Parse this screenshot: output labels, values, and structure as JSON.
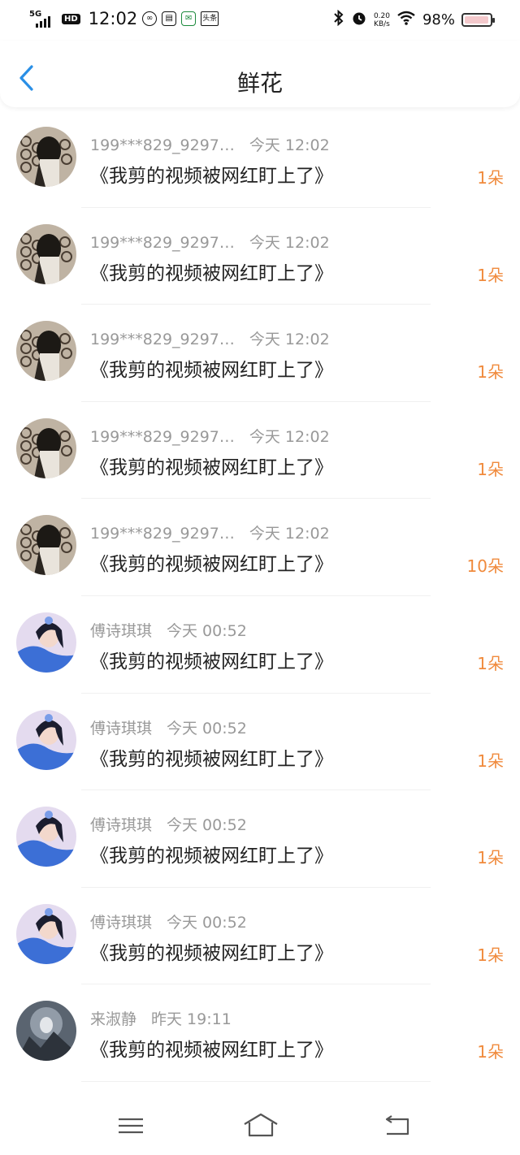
{
  "status_bar": {
    "network": "5G",
    "hd": "HD",
    "time": "12:02",
    "net_speed_value": "0.20",
    "net_speed_unit": "KB/s",
    "battery_pct": "98%",
    "battery_level": 0.98,
    "battery_color": "#f4c9cc",
    "mini_icons": [
      "soul-app-icon",
      "calendar-icon",
      "post-icon",
      "toutiao-icon"
    ],
    "mini_texts": [
      "",
      "",
      "",
      "头条"
    ],
    "right_icons": [
      "bluetooth-icon",
      "alarm-icon",
      "wifi-icon"
    ]
  },
  "header": {
    "title": "鲜花",
    "back_icon": "chevron-left-icon",
    "accent": "#2a8fe6"
  },
  "colors": {
    "count": "#f08a3c",
    "meta": "#999999"
  },
  "items": [
    {
      "name": "199***829_9297…",
      "time": "今天 12:02",
      "message": "《我剪的视频被网红盯上了》",
      "count": "1朵",
      "avatar": "avatar-user-199"
    },
    {
      "name": "199***829_9297…",
      "time": "今天 12:02",
      "message": "《我剪的视频被网红盯上了》",
      "count": "1朵",
      "avatar": "avatar-user-199"
    },
    {
      "name": "199***829_9297…",
      "time": "今天 12:02",
      "message": "《我剪的视频被网红盯上了》",
      "count": "1朵",
      "avatar": "avatar-user-199"
    },
    {
      "name": "199***829_9297…",
      "time": "今天 12:02",
      "message": "《我剪的视频被网红盯上了》",
      "count": "1朵",
      "avatar": "avatar-user-199"
    },
    {
      "name": "199***829_9297…",
      "time": "今天 12:02",
      "message": "《我剪的视频被网红盯上了》",
      "count": "10朵",
      "avatar": "avatar-user-199"
    },
    {
      "name": "傅诗琪琪",
      "time": "今天 00:52",
      "message": "《我剪的视频被网红盯上了》",
      "count": "1朵",
      "avatar": "avatar-user-fu"
    },
    {
      "name": "傅诗琪琪",
      "time": "今天 00:52",
      "message": "《我剪的视频被网红盯上了》",
      "count": "1朵",
      "avatar": "avatar-user-fu"
    },
    {
      "name": "傅诗琪琪",
      "time": "今天 00:52",
      "message": "《我剪的视频被网红盯上了》",
      "count": "1朵",
      "avatar": "avatar-user-fu"
    },
    {
      "name": "傅诗琪琪",
      "time": "今天 00:52",
      "message": "《我剪的视频被网红盯上了》",
      "count": "1朵",
      "avatar": "avatar-user-fu"
    },
    {
      "name": "来淑静",
      "time": "昨天 19:11",
      "message": "《我剪的视频被网红盯上了》",
      "count": "1朵",
      "avatar": "avatar-user-lai"
    }
  ],
  "nav_bar": {
    "buttons": [
      "menu-icon",
      "home-icon",
      "back-icon"
    ]
  }
}
